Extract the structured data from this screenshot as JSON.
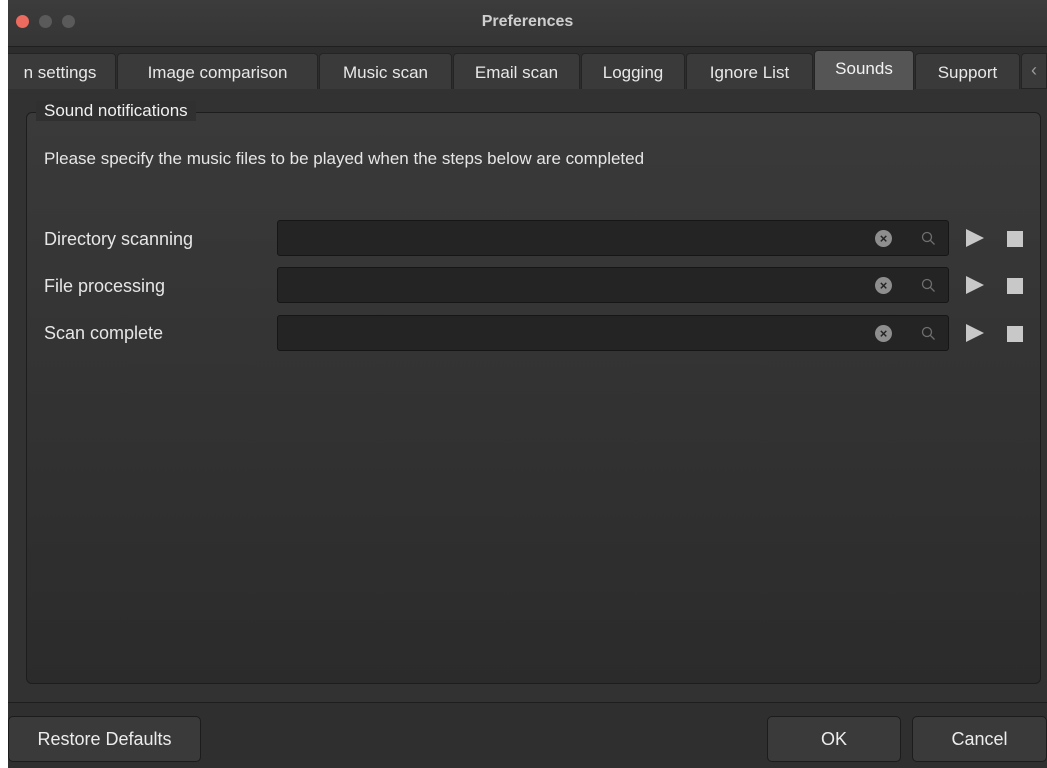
{
  "window": {
    "title": "Preferences"
  },
  "tabs": [
    {
      "label": "n settings",
      "active": false
    },
    {
      "label": "Image comparison",
      "active": false
    },
    {
      "label": "Music scan",
      "active": false
    },
    {
      "label": "Email scan",
      "active": false
    },
    {
      "label": "Logging",
      "active": false
    },
    {
      "label": "Ignore List",
      "active": false
    },
    {
      "label": "Sounds",
      "active": true
    },
    {
      "label": "Support",
      "active": false
    }
  ],
  "tab_scroll_glyph": "‹",
  "sound_notifications": {
    "group_title": "Sound notifications",
    "description": "Please specify the music files to be played when the steps below are completed",
    "rows": [
      {
        "label": "Directory scanning",
        "value": ""
      },
      {
        "label": "File processing",
        "value": ""
      },
      {
        "label": "Scan complete",
        "value": ""
      }
    ]
  },
  "icons": {
    "clear": "clear-icon",
    "search": "search-icon",
    "play": "play-icon",
    "stop": "stop-icon"
  },
  "buttons": {
    "restore_defaults": "Restore Defaults",
    "ok": "OK",
    "cancel": "Cancel"
  },
  "colors": {
    "close_button": "#ed6a5e",
    "window_bg": "#323232",
    "active_tab": "#555555"
  }
}
